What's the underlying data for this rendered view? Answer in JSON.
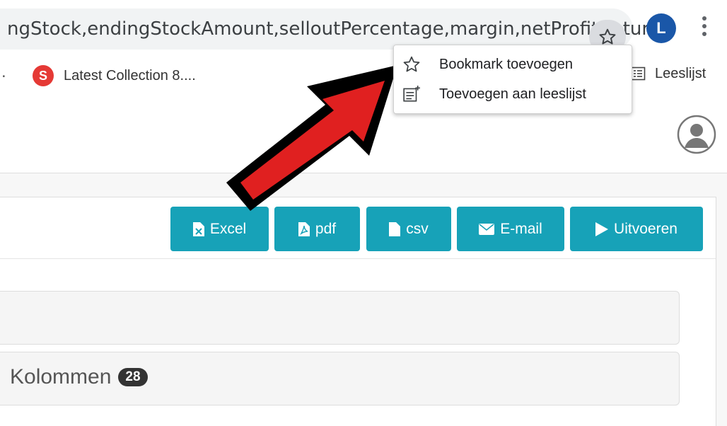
{
  "browser": {
    "url_text": "ngStock,endingStockAmount,selloutPercentage,margin,netProfit,retur...",
    "profile_letter": "L"
  },
  "bookmarks_bar": {
    "overflow": ".",
    "item_label": "Latest Collection 8....",
    "item_favicon": "S",
    "reading_list_label": "Leeslijst"
  },
  "bookmark_menu": {
    "items": [
      {
        "label": "Bookmark toevoegen",
        "icon": "star-icon"
      },
      {
        "label": "Toevoegen aan leeslijst",
        "icon": "reading-list-add-icon"
      }
    ]
  },
  "toolbar": {
    "buttons": [
      {
        "label": "Excel",
        "icon": "file-excel-icon"
      },
      {
        "label": "pdf",
        "icon": "file-pdf-icon"
      },
      {
        "label": "csv",
        "icon": "file-icon"
      },
      {
        "label": "E-mail",
        "icon": "envelope-icon"
      },
      {
        "label": "Uitvoeren",
        "icon": "play-icon"
      }
    ]
  },
  "columns_section": {
    "label": "Kolommen",
    "count": "28"
  },
  "colors": {
    "accent": "#17a2b8",
    "arrow_fill": "#e02020",
    "profile_blue": "#1a57a8"
  }
}
